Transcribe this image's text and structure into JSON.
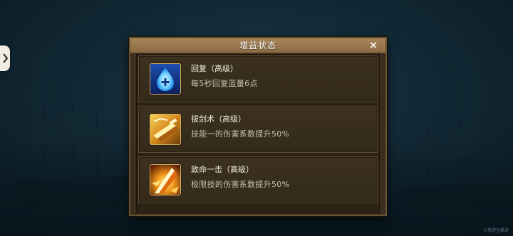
{
  "dialog": {
    "title": "增益状态",
    "close_label": "✕"
  },
  "buffs": [
    {
      "name": "回复（高级）",
      "description": "每5秒回复蓝量6点",
      "icon": "mana-regen-icon"
    },
    {
      "name": "拔剑术（高级）",
      "description": "技能一的伤害系数提升50%",
      "icon": "sword-draw-icon"
    },
    {
      "name": "致命一击（高级）",
      "description": "极限技的伤害系数提升50%",
      "icon": "critical-strike-icon"
    }
  ],
  "side_tab": {
    "icon": "chevron-right-icon"
  },
  "watermark": "©悠游生酷游",
  "colors": {
    "panel_header": "#a8865a",
    "panel_bg": "#3a2e1e",
    "item_border": "#5e4a2c",
    "title_text": "#ffffff",
    "name_text": "#f2ece0",
    "desc_text": "#c9c0ad"
  }
}
